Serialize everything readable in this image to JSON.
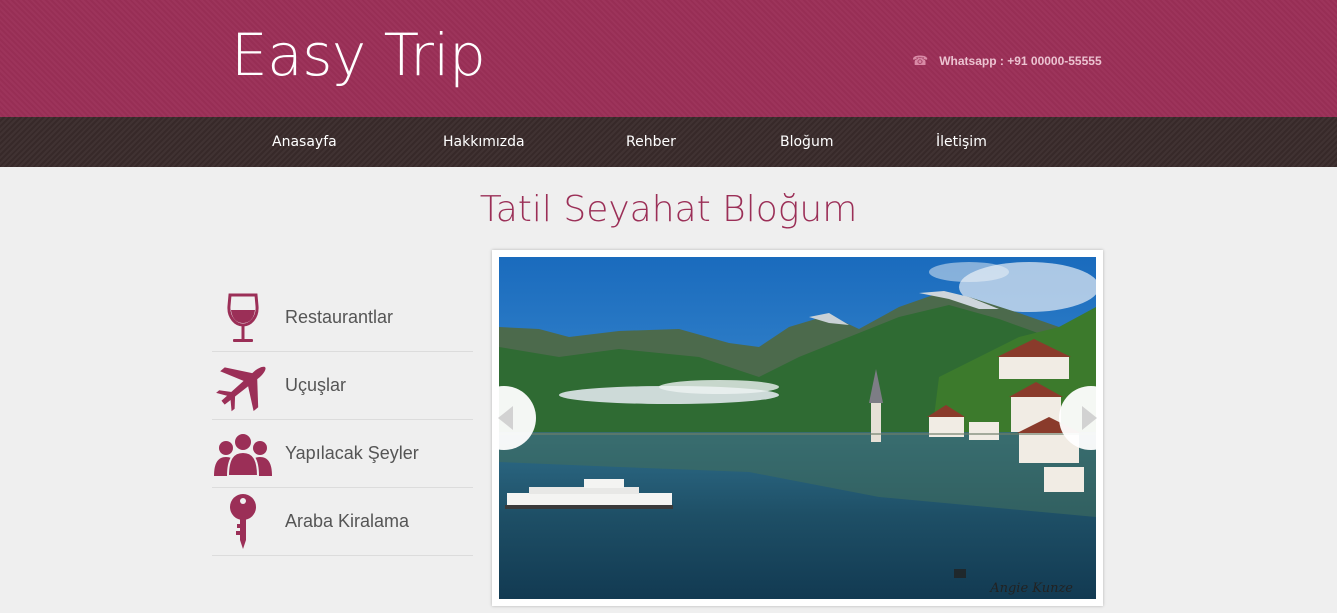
{
  "header": {
    "logo": "Easy Trip",
    "contact_icon": "phone-icon",
    "contact": "Whatsapp : +91 00000-55555"
  },
  "nav": {
    "items": [
      {
        "label": "Anasayfa"
      },
      {
        "label": "Hakkımızda"
      },
      {
        "label": "Rehber"
      },
      {
        "label": "Bloğum"
      },
      {
        "label": "İletişim"
      }
    ]
  },
  "main": {
    "title": "Tatil Seyahat Bloğum"
  },
  "sidebar": {
    "items": [
      {
        "label": "Restaurantlar",
        "icon": "wine-glass-icon"
      },
      {
        "label": "Uçuşlar",
        "icon": "airplane-icon"
      },
      {
        "label": "Yapılacak Şeyler",
        "icon": "people-icon"
      },
      {
        "label": "Araba Kiralama",
        "icon": "key-icon"
      }
    ]
  },
  "slider": {
    "credit": "Angie Kunze",
    "prev_icon": "chevron-left-icon",
    "next_icon": "chevron-right-icon"
  },
  "colors": {
    "brand": "#9b2f57",
    "nav_bg": "#3a2b2b",
    "page_bg": "#efefef"
  }
}
